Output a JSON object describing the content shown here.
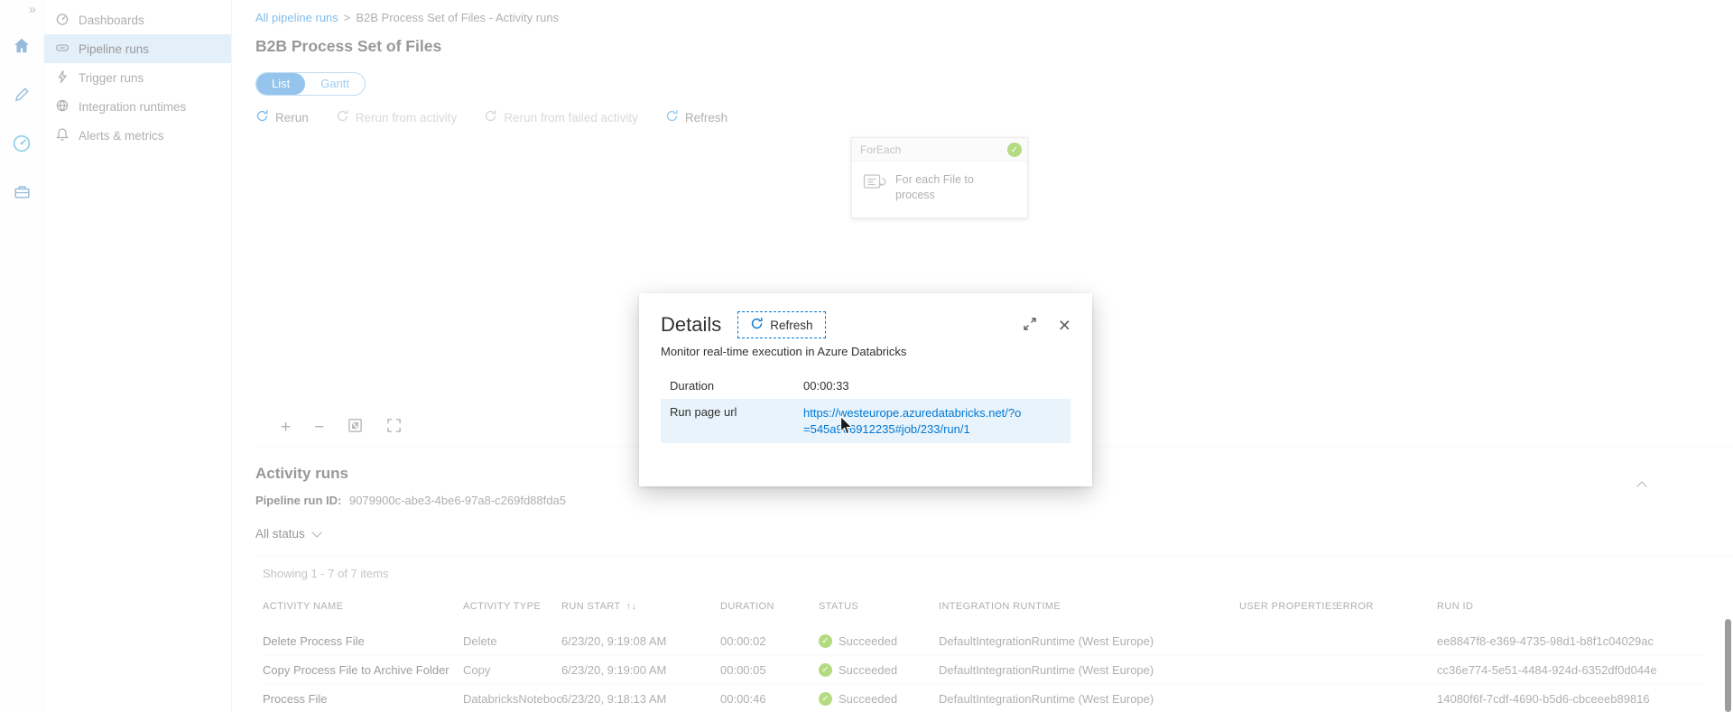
{
  "icons": {
    "double_chevron": "»",
    "close": "×",
    "check": "✓",
    "plus": "+",
    "minus": "−",
    "sort": "↑↓"
  },
  "colors": {
    "accent": "#0078d4",
    "success_green": "#6bb700",
    "selected_sidebar_bg": "#c7e0f4",
    "highlight_row_bg": "#e8f3fb"
  },
  "sidebar": {
    "items": [
      {
        "label": "Dashboards",
        "active": false
      },
      {
        "label": "Pipeline runs",
        "active": true
      },
      {
        "label": "Trigger runs",
        "active": false
      },
      {
        "label": "Integration runtimes",
        "active": false
      },
      {
        "label": "Alerts & metrics",
        "active": false
      }
    ]
  },
  "breadcrumb": {
    "link": "All pipeline runs",
    "separator": ">",
    "current": "B2B Process Set of Files - Activity runs"
  },
  "page": {
    "title": "B2B Process Set of Files"
  },
  "view_toggle": {
    "options": [
      "List",
      "Gantt"
    ],
    "selected": "List"
  },
  "toolbar": {
    "buttons": [
      {
        "label": "Rerun",
        "enabled": true
      },
      {
        "label": "Rerun from activity",
        "enabled": false
      },
      {
        "label": "Rerun from failed activity",
        "enabled": false
      },
      {
        "label": "Refresh",
        "enabled": true
      }
    ]
  },
  "canvas": {
    "node": {
      "type": "ForEach",
      "title": "For each File to process",
      "status": "Succeeded"
    }
  },
  "details_dialog": {
    "title": "Details",
    "refresh_label": "Refresh",
    "subtitle": "Monitor real-time execution in Azure Databricks",
    "rows": [
      {
        "label": "Duration",
        "value": "00:00:33",
        "highlighted": false,
        "is_link": false
      },
      {
        "label": "Run page url",
        "value": "https://westeurope.azuredatabricks.net/?o=545a906912235#job/233/run/1",
        "highlighted": true,
        "is_link": true
      }
    ]
  },
  "activity_runs": {
    "title": "Activity runs",
    "pipeline_run_id_label": "Pipeline run ID:",
    "pipeline_run_id": "9079900c-abe3-4be6-97a8-c269fd88fda5",
    "status_filter": "All status",
    "showing": "Showing 1 - 7 of 7 items",
    "columns": [
      "ACTIVITY NAME",
      "ACTIVITY TYPE",
      "RUN START",
      "DURATION",
      "STATUS",
      "INTEGRATION RUNTIME",
      "USER PROPERTIES",
      "ERROR",
      "RUN ID"
    ],
    "rows": [
      {
        "name": "Delete Process File",
        "type": "Delete",
        "start": "6/23/20, 9:19:08 AM",
        "duration": "00:00:02",
        "status": "Succeeded",
        "runtime": "DefaultIntegrationRuntime (West Europe)",
        "user_properties": "",
        "error": "",
        "run_id": "ee8847f8-e369-4735-98d1-b8f1c04029ac"
      },
      {
        "name": "Copy Process File to Archive Folder",
        "type": "Copy",
        "start": "6/23/20, 9:19:00 AM",
        "duration": "00:00:05",
        "status": "Succeeded",
        "runtime": "DefaultIntegrationRuntime (West Europe)",
        "user_properties": "",
        "error": "",
        "run_id": "cc36e774-5e51-4484-924d-6352df0d044e"
      },
      {
        "name": "Process File",
        "type": "DatabricksNotebook",
        "start": "6/23/20, 9:18:13 AM",
        "duration": "00:00:46",
        "status": "Succeeded",
        "runtime": "DefaultIntegrationRuntime (West Europe)",
        "user_properties": "",
        "error": "",
        "run_id": "14080f6f-7cdf-4690-b5d6-cbceeeb89816"
      }
    ]
  }
}
